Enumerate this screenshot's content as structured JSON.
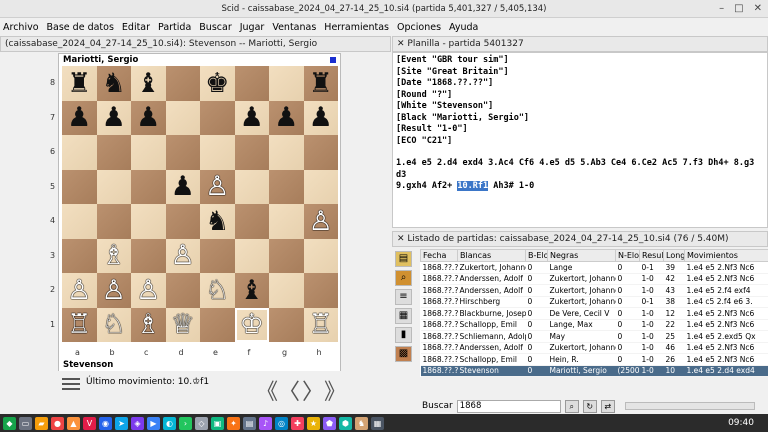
{
  "window": {
    "title": "Scid - caissabase_2024_04_27-14_25_10.si4 (partida 5,401,327 / 5,405,134)"
  },
  "menu": [
    "Archivo",
    "Base de datos",
    "Editar",
    "Partida",
    "Buscar",
    "Jugar",
    "Ventanas",
    "Herramientas",
    "Opciones",
    "Ayuda"
  ],
  "board_panel": {
    "title": "(caissabase_2024_04_27-14_25_10.si4): Stevenson -- Mariotti, Sergio",
    "top_player": "Mariotti, Sergio",
    "bottom_player": "Stevenson",
    "last_move_label": "Último movimiento: 10.♔f1",
    "ranks": [
      "8",
      "7",
      "6",
      "5",
      "4",
      "3",
      "2",
      "1"
    ],
    "files": [
      "a",
      "b",
      "c",
      "d",
      "e",
      "f",
      "g",
      "h"
    ],
    "position": [
      [
        "♜",
        "♞",
        "♝",
        "",
        "♚",
        "",
        "",
        "♜"
      ],
      [
        "♟",
        "♟",
        "♟",
        "",
        "",
        "♟",
        "♟",
        "♟"
      ],
      [
        "",
        "",
        "",
        "",
        "",
        "",
        "",
        ""
      ],
      [
        "",
        "",
        "",
        "♟",
        "♙",
        "",
        "",
        ""
      ],
      [
        "",
        "",
        "",
        "",
        "♞",
        "",
        "",
        "♙"
      ],
      [
        "",
        "♗",
        "",
        "♙",
        "",
        "",
        "",
        ""
      ],
      [
        "♙",
        "♙",
        "♙",
        "",
        "♘",
        "♝",
        "",
        ""
      ],
      [
        "♖",
        "♘",
        "♗",
        "♕",
        "",
        "♔",
        "",
        "♖"
      ]
    ],
    "nav": [
      "《",
      "〈",
      "〉",
      "》"
    ]
  },
  "pgn_panel": {
    "title": "Planilla - partida 5401327",
    "headers": [
      "[Event \"GBR tour sim\"]",
      "[Site \"Great Britain\"]",
      "[Date \"1868.??.??\"]",
      "[Round \"?\"]",
      "[White \"Stevenson\"]",
      "[Black \"Mariotti, Sergio\"]",
      "[Result \"1-0\"]",
      "[ECO \"C21\"]"
    ],
    "moves_line1": "1.e4 e5 2.d4 exd4 3.Ac4 Cf6 4.e5 d5 5.Ab3 Ce4 6.Ce2 Ac5 7.f3 Dh4+ 8.g3 d3",
    "moves_line2_pre": "9.gxh4 Af2+ ",
    "moves_current": "10.Rf1",
    "moves_line2_post": " Ah3# 1-0"
  },
  "game_list": {
    "title": "Listado de partidas: caissabase_2024_04_27-14_25_10.si4 (76 / 5.40M)",
    "columns": [
      "Fecha",
      "Blancas",
      "B-Elo",
      "Negras",
      "N-Elo",
      "Result",
      "Long",
      "Movimientos"
    ],
    "rows": [
      [
        "1868.??.??",
        "Zukertort, Johanne",
        "0",
        "Lange",
        "0",
        "0-1",
        "39",
        "1.e4 e5 2.Nf3 Nc6"
      ],
      [
        "1868.??.??",
        "Anderssen, Adolf",
        "0",
        "Zukertort, Johanne",
        "0",
        "1-0",
        "42",
        "1.e4 e5 2.Nf3 Nc6"
      ],
      [
        "1868.??.??",
        "Anderssen, Adolf",
        "0",
        "Zukertort, Johanne",
        "0",
        "1-0",
        "43",
        "1.e4 e5 2.f4 exf4"
      ],
      [
        "1868.??.??",
        "Hirschberg",
        "0",
        "Zukertort, Johanne",
        "0",
        "0-1",
        "38",
        "1.e4 c5 2.f4 e6 3."
      ],
      [
        "1868.??.??",
        "Blackburne, Joseph",
        "0",
        "De Vere, Cecil V",
        "0",
        "1-0",
        "12",
        "1.e4 e5 2.Nf3 Nc6"
      ],
      [
        "1868.??.??",
        "Schallopp, Emil",
        "0",
        "Lange, Max",
        "0",
        "1-0",
        "22",
        "1.e4 e5 2.Nf3 Nc6"
      ],
      [
        "1868.??.??",
        "Schliemann, Adolph",
        "0",
        "May",
        "0",
        "1-0",
        "25",
        "1.e4 e5 2.exd5 Qx"
      ],
      [
        "1868.??.??",
        "Anderssen, Adolf",
        "0",
        "Zukertort, Johanne",
        "0",
        "1-0",
        "46",
        "1.e4 e5 2.Nf3 Nc6"
      ],
      [
        "1868.??.??",
        "Schallopp, Emil",
        "0",
        "Hein, R.",
        "0",
        "1-0",
        "26",
        "1.e4 e5 2.Nf3 Nc6"
      ],
      [
        "1868.??.??",
        "Stevenson",
        "0",
        "Mariotti, Sergio",
        "(2500",
        "1-0",
        "10",
        "1.e4 e5 2.d4 exd4"
      ]
    ],
    "selected_index": 9
  },
  "search": {
    "label": "Buscar",
    "value": "1868"
  },
  "clock": "09:40"
}
